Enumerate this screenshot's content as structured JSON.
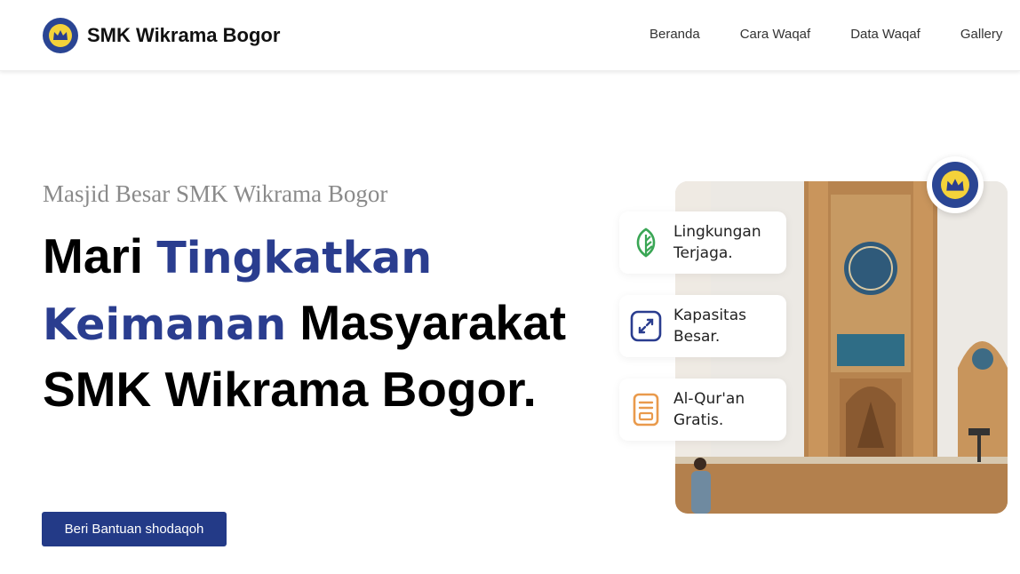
{
  "brand": {
    "name": "SMK Wikrama Bogor"
  },
  "nav": {
    "items": [
      "Beranda",
      "Cara Waqaf",
      "Data Waqaf",
      "Gallery"
    ]
  },
  "hero": {
    "subtitle": "Masjid Besar SMK Wikrama Bogor",
    "headline": {
      "part1": "Mari ",
      "highlight1": "Tingkatkan",
      "highlight2": "Keimanan",
      "part2": " Masyarakat",
      "part3": "SMK Wikrama Bogor."
    },
    "cta_label": "Beri Bantuan shodaqoh"
  },
  "features": [
    {
      "icon": "leaf-icon",
      "line1": "Lingkungan",
      "line2": "Terjaga.",
      "color": "#3aa655"
    },
    {
      "icon": "expand-icon",
      "line1": "Kapasitas",
      "line2": "Besar.",
      "color": "#2a3d8f"
    },
    {
      "icon": "document-icon",
      "line1": "Al-Qur'an",
      "line2": "Gratis.",
      "color": "#e99a4c"
    }
  ],
  "colors": {
    "brand_blue": "#2a3d8f",
    "button": "#233a87",
    "subtitle": "#8a8a8a"
  }
}
